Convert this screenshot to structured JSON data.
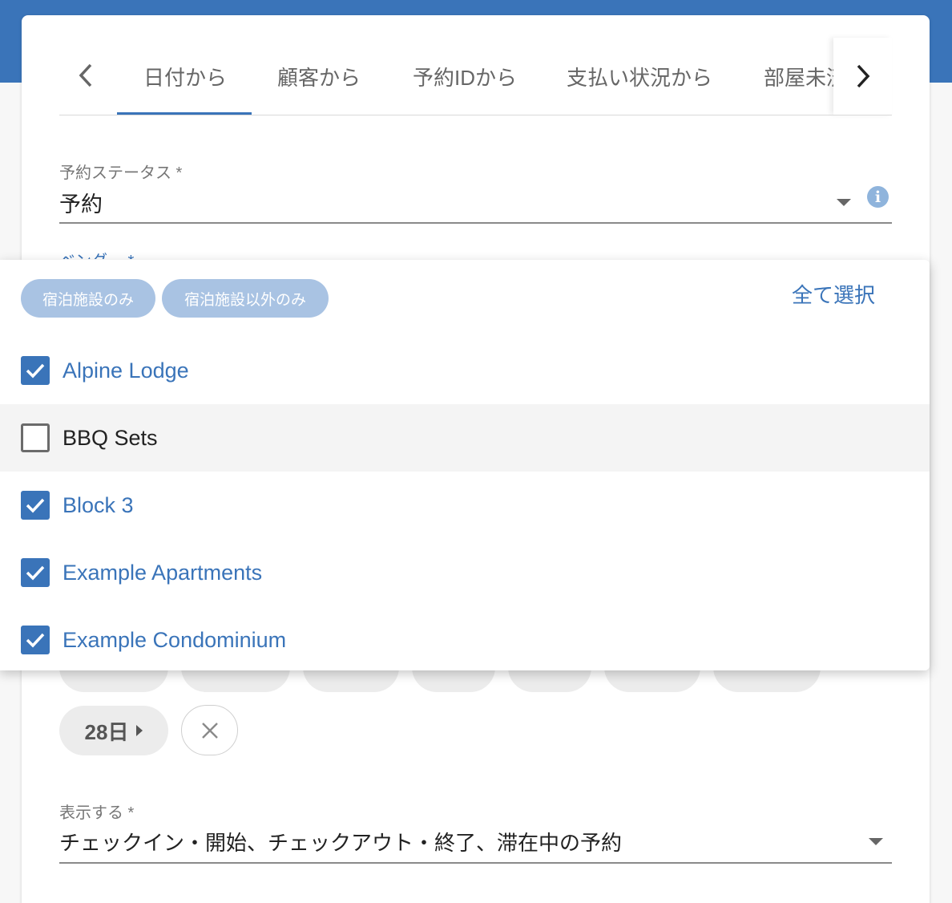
{
  "tabs": {
    "items": [
      "日付から",
      "顧客から",
      "予約IDから",
      "支払い状況から",
      "部屋未済"
    ],
    "active_index": 0
  },
  "status_field": {
    "label": "予約ステータス *",
    "value": "予約"
  },
  "vendor_field": {
    "label": "ベンダー *"
  },
  "dropdown": {
    "filter_chips": [
      "宿泊施設のみ",
      "宿泊施設以外のみ"
    ],
    "select_all": "全て選択",
    "options": [
      {
        "label": "Alpine Lodge",
        "checked": true
      },
      {
        "label": "BBQ Sets",
        "checked": false
      },
      {
        "label": "Block 3",
        "checked": true
      },
      {
        "label": "Example Apartments",
        "checked": true
      },
      {
        "label": "Example Condominium",
        "checked": true
      }
    ]
  },
  "date_chips": {
    "last": "28日"
  },
  "display_field": {
    "label": "表示する *",
    "value": "チェックイン・開始、チェックアウト・終了、滞在中の予約"
  },
  "colors": {
    "primary": "#3a74b9",
    "chip_disabled": "#a9c3e3"
  }
}
